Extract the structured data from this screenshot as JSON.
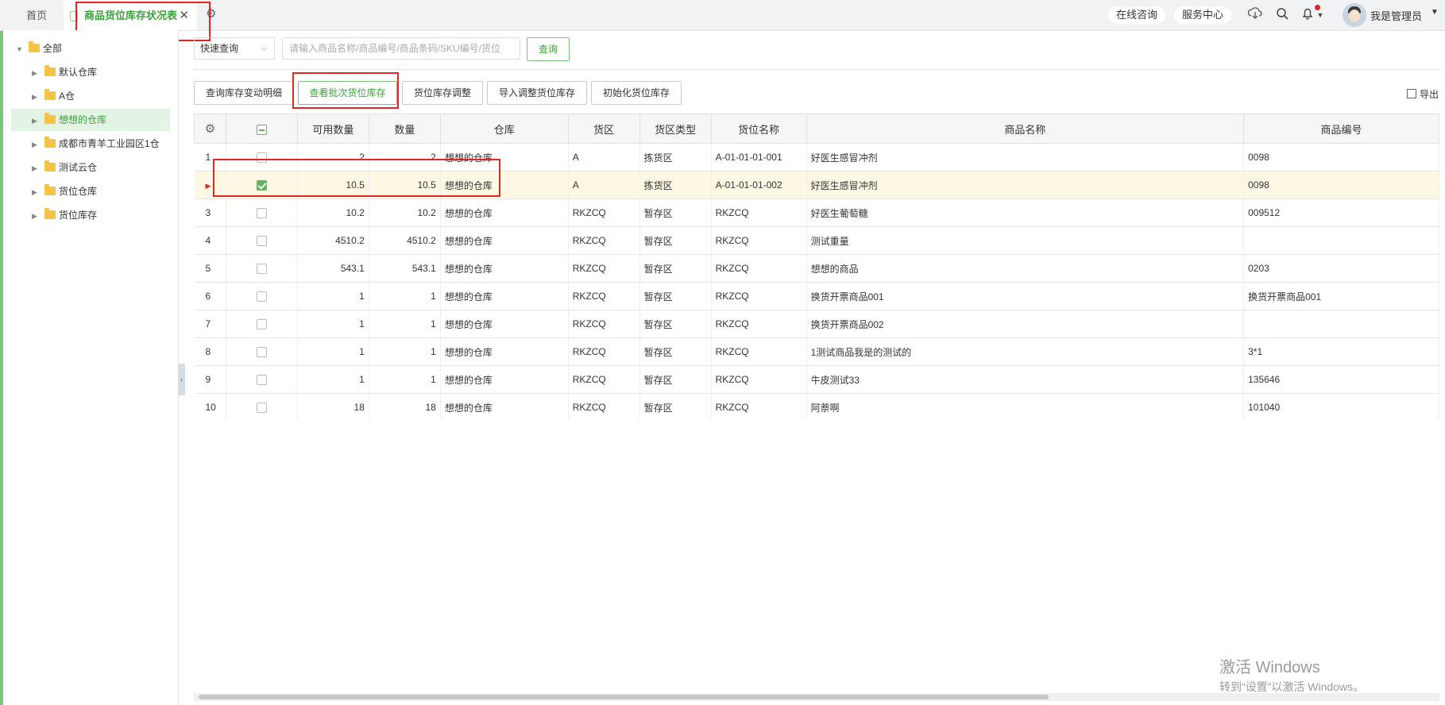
{
  "tabs": {
    "home": "首页",
    "active": "商品货位库存状况表"
  },
  "header": {
    "online_consult": "在线咨询",
    "service_center": "服务中心",
    "user_name": "我是管理员"
  },
  "tree": {
    "root": "全部",
    "items": [
      "默认仓库",
      "A仓",
      "想想的仓库",
      "成都市青羊工业园区1仓",
      "测试云仓",
      "货位仓库",
      "货位库存"
    ]
  },
  "search": {
    "mode": "快速查询",
    "placeholder": "请输入商品名称/商品编号/商品条码/SKU编号/货位",
    "button": "查询"
  },
  "toolbar": {
    "btn1": "查询库存变动明细",
    "btn2": "查看批次货位库存",
    "btn3": "货位库存调整",
    "btn4": "导入调整货位库存",
    "btn5": "初始化货位库存",
    "export": "导出"
  },
  "table": {
    "headers": {
      "available": "可用数量",
      "qty": "数量",
      "warehouse": "仓库",
      "zone": "货区",
      "zone_type": "货区类型",
      "location": "货位名称",
      "product_name": "商品名称",
      "product_code": "商品编号"
    },
    "rows": [
      {
        "idx": "1",
        "checked": false,
        "available": "2",
        "qty": "2",
        "warehouse": "想想的仓库",
        "zone": "A",
        "zone_type": "拣货区",
        "location": "A-01-01-01-001",
        "product_name": "好医生感冒冲剂",
        "product_code": "0098"
      },
      {
        "idx": "",
        "checked": true,
        "available": "10.5",
        "qty": "10.5",
        "warehouse": "想想的仓库",
        "zone": "A",
        "zone_type": "拣货区",
        "location": "A-01-01-01-002",
        "product_name": "好医生感冒冲剂",
        "product_code": "0098"
      },
      {
        "idx": "3",
        "checked": false,
        "available": "10.2",
        "qty": "10.2",
        "warehouse": "想想的仓库",
        "zone": "RKZCQ",
        "zone_type": "暂存区",
        "location": "RKZCQ",
        "product_name": "好医生葡萄糖",
        "product_code": "009512"
      },
      {
        "idx": "4",
        "checked": false,
        "available": "4510.2",
        "qty": "4510.2",
        "warehouse": "想想的仓库",
        "zone": "RKZCQ",
        "zone_type": "暂存区",
        "location": "RKZCQ",
        "product_name": "测试重量",
        "product_code": ""
      },
      {
        "idx": "5",
        "checked": false,
        "available": "543.1",
        "qty": "543.1",
        "warehouse": "想想的仓库",
        "zone": "RKZCQ",
        "zone_type": "暂存区",
        "location": "RKZCQ",
        "product_name": "想想的商品",
        "product_code": "0203"
      },
      {
        "idx": "6",
        "checked": false,
        "available": "1",
        "qty": "1",
        "warehouse": "想想的仓库",
        "zone": "RKZCQ",
        "zone_type": "暂存区",
        "location": "RKZCQ",
        "product_name": "换货开票商品001",
        "product_code": "换货开票商品001"
      },
      {
        "idx": "7",
        "checked": false,
        "available": "1",
        "qty": "1",
        "warehouse": "想想的仓库",
        "zone": "RKZCQ",
        "zone_type": "暂存区",
        "location": "RKZCQ",
        "product_name": "换货开票商品002",
        "product_code": ""
      },
      {
        "idx": "8",
        "checked": false,
        "available": "1",
        "qty": "1",
        "warehouse": "想想的仓库",
        "zone": "RKZCQ",
        "zone_type": "暂存区",
        "location": "RKZCQ",
        "product_name": "1测试商品我是的测试的",
        "product_code": "3*1"
      },
      {
        "idx": "9",
        "checked": false,
        "available": "1",
        "qty": "1",
        "warehouse": "想想的仓库",
        "zone": "RKZCQ",
        "zone_type": "暂存区",
        "location": "RKZCQ",
        "product_name": "牛皮测试33",
        "product_code": "135646"
      },
      {
        "idx": "10",
        "checked": false,
        "available": "18",
        "qty": "18",
        "warehouse": "想想的仓库",
        "zone": "RKZCQ",
        "zone_type": "暂存区",
        "location": "RKZCQ",
        "product_name": "阿萘啊",
        "product_code": "101040"
      }
    ]
  },
  "watermark": {
    "line1": "激活 Windows",
    "line2": "转到“设置”以激活 Windows。"
  },
  "colors": {
    "accent": "#3aa33a",
    "highlight": "#e52525",
    "selected_row": "#fdf8e4"
  },
  "icons": {
    "gear": "gear-icon",
    "download": "download-icon",
    "search": "search-icon",
    "bell": "bell-icon",
    "export": "export-icon",
    "folder": "folder-icon"
  }
}
